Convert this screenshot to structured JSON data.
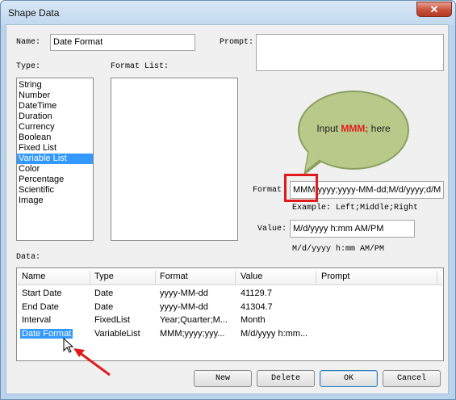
{
  "window": {
    "title": "Shape Data",
    "close_glyph": "✕"
  },
  "name": {
    "label": "Name:",
    "value": "Date Format"
  },
  "prompt": {
    "label": "Prompt:",
    "value": ""
  },
  "type": {
    "label": "Type:",
    "items": [
      "String",
      "Number",
      "DateTime",
      "Duration",
      "Currency",
      "Boolean",
      "Fixed List",
      "Variable List",
      "Color",
      "Percentage",
      "Scientific",
      "Image"
    ],
    "selected": "Variable List"
  },
  "format_list": {
    "label": "Format List:"
  },
  "callout": {
    "prefix": "Input ",
    "highlight": "MMM;",
    "suffix": " here"
  },
  "format": {
    "label": "Format",
    "value": "MMM;yyyy;yyyy-MM-dd;M/d/yyyy;d/M",
    "example": "Example: Left;Middle;Right"
  },
  "value": {
    "label": "Value:",
    "value": "M/d/yyyy h:mm AM/PM",
    "preview": "M/d/yyyy h:mm AM/PM"
  },
  "data": {
    "label": "Data:",
    "columns": [
      "Name",
      "Type",
      "Format",
      "Value",
      "Prompt"
    ],
    "rows": [
      {
        "name": "Start Date",
        "type": "Date",
        "format": "yyyy-MM-dd",
        "value": "41129.7",
        "prompt": ""
      },
      {
        "name": "End Date",
        "type": "Date",
        "format": "yyyy-MM-dd",
        "value": "41304.7",
        "prompt": ""
      },
      {
        "name": "Interval",
        "type": "FixedList",
        "format": "Year;Quarter;M...",
        "value": "Month",
        "prompt": ""
      },
      {
        "name": "Date Format",
        "type": "VariableList",
        "format": "MMM;yyyy;yyy...",
        "value": "M/d/yyyy h:mm...",
        "prompt": ""
      }
    ],
    "selected_row": 3
  },
  "buttons": {
    "new": "New",
    "delete": "Delete",
    "ok": "OK",
    "cancel": "Cancel"
  },
  "colors": {
    "highlight": "#e02020",
    "selection": "#3399ff",
    "callout": "#b8c98a"
  }
}
